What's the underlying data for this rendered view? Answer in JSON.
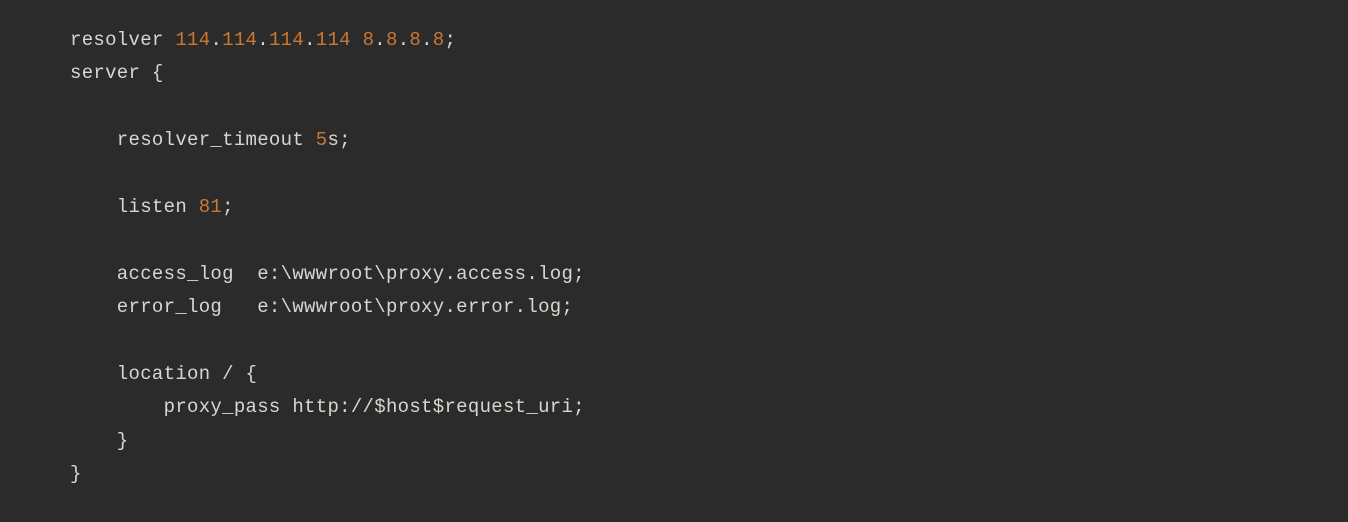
{
  "code": {
    "line1": {
      "t1": "resolver ",
      "n1": "114",
      "d1": ".",
      "n2": "114",
      "d2": ".",
      "n3": "114",
      "d3": ".",
      "n4": "114",
      "sp": " ",
      "n5": "8",
      "d4": ".",
      "n6": "8",
      "d5": ".",
      "n7": "8",
      "d6": ".",
      "n8": "8",
      "end": ";"
    },
    "line2": {
      "t1": "server {"
    },
    "line3": {
      "blank": ""
    },
    "line4": {
      "t1": "    resolver_timeout ",
      "n1": "5",
      "t2": "s;"
    },
    "line5": {
      "blank": ""
    },
    "line6": {
      "t1": "    listen ",
      "n1": "81",
      "t2": ";"
    },
    "line7": {
      "blank": ""
    },
    "line8": {
      "t1": "    access_log  e:\\wwwroot\\proxy.access.log;"
    },
    "line9": {
      "t1": "    error_log   e:\\wwwroot\\proxy.error.log;"
    },
    "line10": {
      "blank": ""
    },
    "line11": {
      "t1": "    location / {"
    },
    "line12": {
      "t1": "        proxy_pass http://$host$request_uri;"
    },
    "line13": {
      "t1": "    }"
    },
    "line14": {
      "t1": "}"
    }
  }
}
